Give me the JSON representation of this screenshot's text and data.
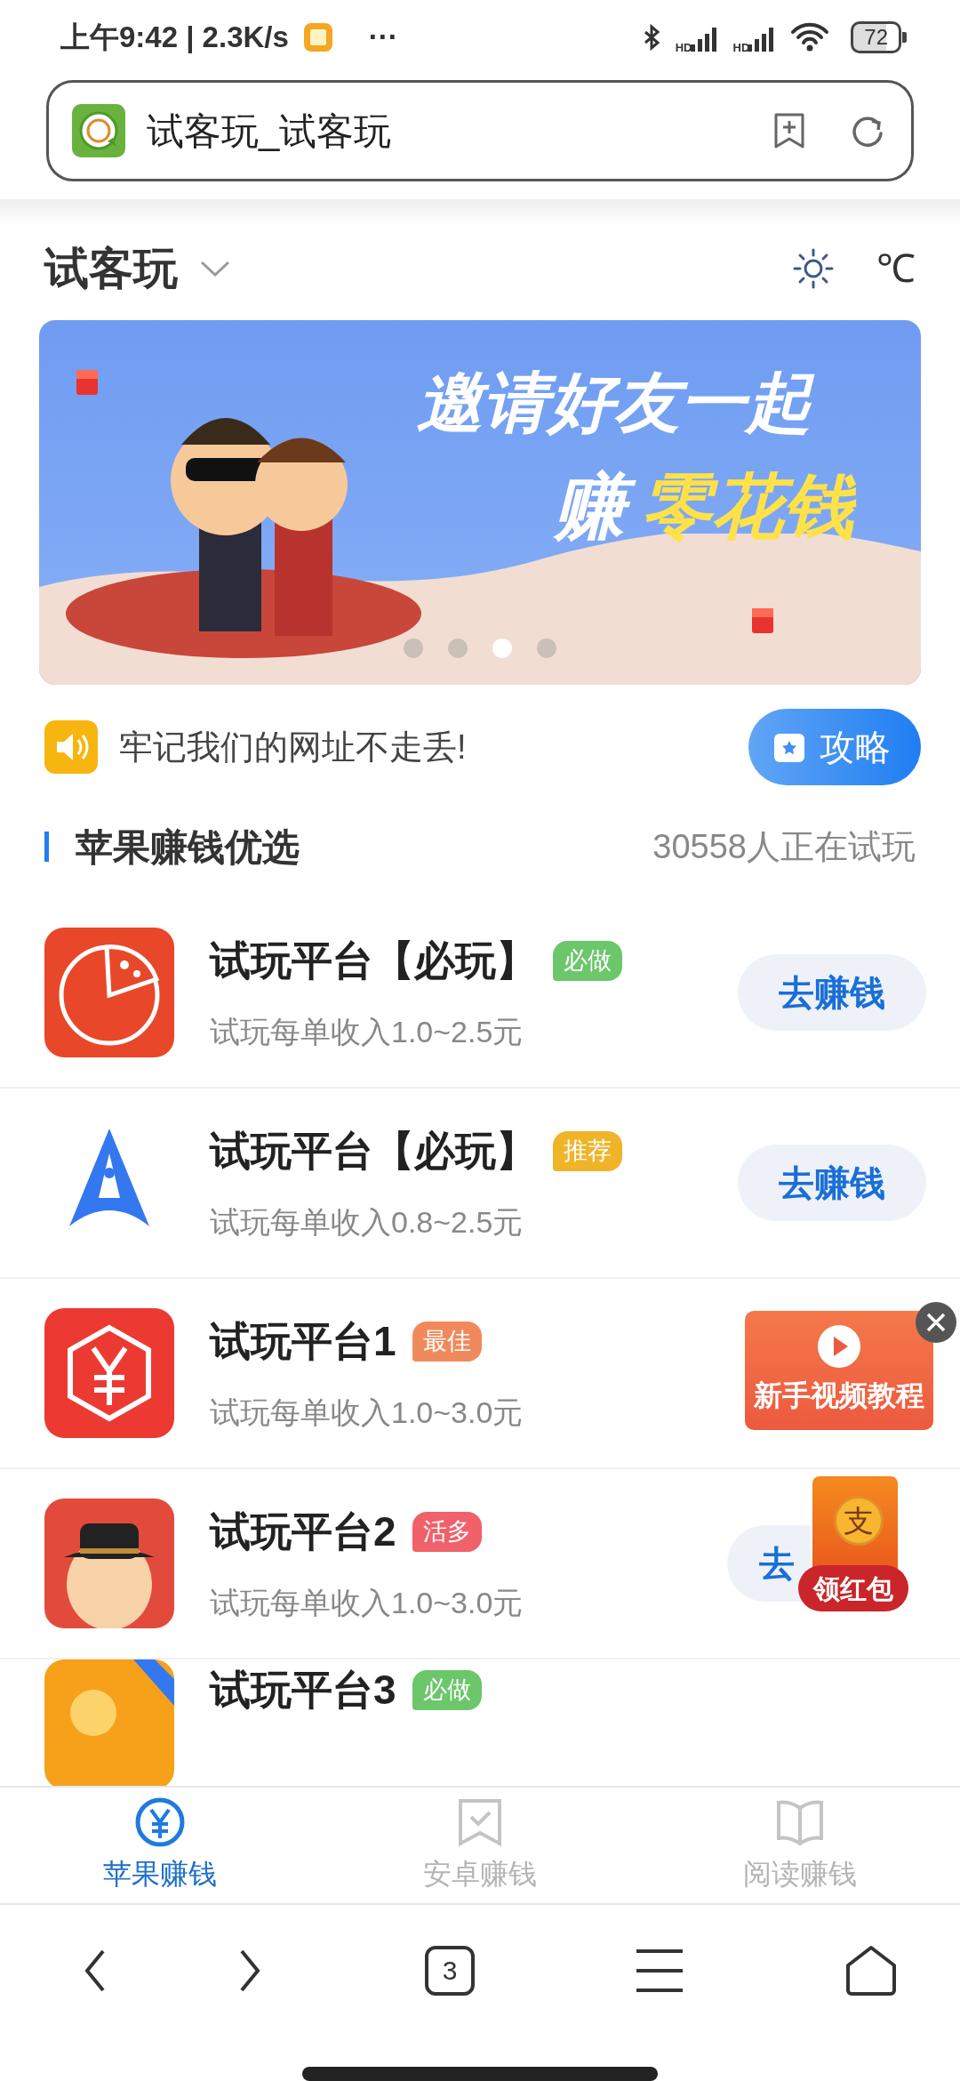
{
  "status_bar": {
    "time": "上午9:42 | 2.3K/s",
    "more": "···",
    "sim_labels": [
      "HD",
      "HD"
    ],
    "battery": "72"
  },
  "address_bar": {
    "title": "试客玩_试客玩"
  },
  "header": {
    "title": "试客玩",
    "unit": "℃"
  },
  "banner": {
    "line_1": "邀请好友一起",
    "line_2_start": "赚",
    "line_2_highlight": "零花钱",
    "dots": [
      {
        "selected": false
      },
      {
        "selected": false
      },
      {
        "selected": true
      },
      {
        "selected": false
      }
    ]
  },
  "notice": {
    "text": "牢记我们的网址不走丢!",
    "button": "攻略"
  },
  "section": {
    "title": "苹果赚钱优选",
    "count": "30558人正在试玩"
  },
  "apps": [
    {
      "kind": "pie",
      "title": "试玩平台【必玩】",
      "tag": "必做",
      "color": "#6cc66a",
      "subtitle": "试玩每单收入1.0~2.5元",
      "button": "去赚钱"
    },
    {
      "kind": "rocket",
      "title": "试玩平台【必玩】",
      "tag": "推荐",
      "color": "#f0b429",
      "subtitle": "试玩每单收入0.8~2.5元",
      "button": "去赚钱"
    },
    {
      "kind": "yuan",
      "title": "试玩平台1",
      "tag": "最佳",
      "color": "#f08a5d",
      "subtitle": "试玩每单收入1.0~3.0元"
    },
    {
      "kind": "face",
      "title": "试玩平台2",
      "tag": "活多",
      "color": "#f0616a",
      "subtitle": "试玩每单收入1.0~3.0元",
      "button": "去"
    },
    {
      "kind": "coin",
      "title": "试玩平台3",
      "tag": "必做",
      "color": "#6cc66a"
    }
  ],
  "floating": {
    "video_card": "新手视频教程",
    "red_packet": {
      "coin": "支",
      "label": "领红包"
    }
  },
  "tabs": [
    {
      "kind": "yuan",
      "label": "苹果赚钱",
      "selected": true
    },
    {
      "kind": "bookmark",
      "label": "安卓赚钱",
      "selected": false
    },
    {
      "kind": "book",
      "label": "阅读赚钱",
      "selected": false
    }
  ],
  "browser_nav": {
    "tab_count": "3"
  }
}
